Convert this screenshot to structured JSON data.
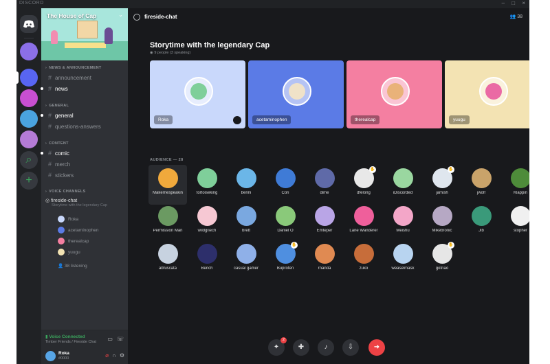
{
  "app": {
    "title": "DISCORD",
    "window_controls": [
      "–",
      "□",
      "×"
    ]
  },
  "servers": [
    {
      "name": "home",
      "color": "#36393f"
    },
    {
      "name": "server-1",
      "color": "#8b6fe8"
    },
    {
      "name": "server-2",
      "color": "#5865f2"
    },
    {
      "name": "server-3",
      "color": "#c94fd1"
    },
    {
      "name": "server-4",
      "color": "#4aa3df"
    },
    {
      "name": "server-5",
      "color": "#b57bd6"
    }
  ],
  "sidebar": {
    "server_name": "The House of Cap",
    "categories": [
      {
        "label": "NEWS & ANNOUNCEMENT",
        "channels": [
          "announcement",
          "news"
        ]
      },
      {
        "label": "GENERAL",
        "channels": [
          "general",
          "questions-answers"
        ]
      },
      {
        "label": "CONTENT",
        "channels": [
          "comic",
          "merch",
          "stickers"
        ]
      },
      {
        "label": "VOICE CHANNELS"
      }
    ],
    "voice_channel": {
      "name": "fireside-chat",
      "topic": "Storytime with the legendary Cap",
      "speakers": [
        "Roka",
        "acetaminophen",
        "therealcap",
        "yuugu"
      ],
      "listening": "38 listening"
    },
    "voice_panel": {
      "status": "Voice Connected",
      "location": "Timber Friends / Fireside Chat"
    },
    "user": {
      "name": "Roka",
      "tag": "#0000"
    }
  },
  "stage": {
    "channel_name": "fireside-chat",
    "member_count": "38",
    "topic": "Storytime with the legendary Cap",
    "subinfo": "9 people (3 speaking)",
    "speakers": [
      {
        "name": "Roka",
        "bg": "#c9d8fb",
        "face": "#7fcf9a"
      },
      {
        "name": "acetaminophen",
        "bg": "#5b7be6",
        "face": "#f0e2c8"
      },
      {
        "name": "therealcap",
        "bg": "#f47fa1",
        "face": "#e9b279"
      },
      {
        "name": "yuugu",
        "bg": "#f3e3b3",
        "face": "#ea6aa4"
      }
    ],
    "audience_label": "AUDIENCE — 28",
    "audience": [
      {
        "name": "Makernespeakin",
        "face": "#f0a93c",
        "hand": false
      },
      {
        "name": "tortoiseking",
        "face": "#7fcf9a",
        "hand": false
      },
      {
        "name": "benni",
        "face": "#6bb6e8",
        "hand": false
      },
      {
        "name": "Cori",
        "face": "#3f7bd6",
        "hand": false
      },
      {
        "name": "dime",
        "face": "#5f6aa8",
        "hand": false
      },
      {
        "name": "dfelong",
        "face": "#e8e8e8",
        "hand": true
      },
      {
        "name": "iDiscorded",
        "face": "#9ad7a0",
        "hand": false
      },
      {
        "name": "jamish",
        "face": "#dfe6ee",
        "hand": true
      },
      {
        "name": "jwolf",
        "face": "#c9a36a",
        "hand": false
      },
      {
        "name": "Klappin",
        "face": "#4e8c3a",
        "hand": false
      },
      {
        "name": "Permission Man",
        "face": "#6b9a62",
        "hand": false
      },
      {
        "name": "wildgriech",
        "face": "#f6c8d3",
        "hand": false
      },
      {
        "name": "brett",
        "face": "#7aa8e0",
        "hand": false
      },
      {
        "name": "Daniel O",
        "face": "#8ac97a",
        "hand": false
      },
      {
        "name": "Emteper",
        "face": "#b9a5e6",
        "hand": false
      },
      {
        "name": "Lane Wanderer",
        "face": "#ef5f9b",
        "hand": false
      },
      {
        "name": "Meishu",
        "face": "#f3a6c8",
        "hand": false
      },
      {
        "name": "Mikebronic",
        "face": "#b6a8c4",
        "hand": false
      },
      {
        "name": "Jib",
        "face": "#3a9a7a",
        "hand": false
      },
      {
        "name": "stopher",
        "face": "#f0f0f0",
        "hand": false
      },
      {
        "name": "abfuscata",
        "face": "#c7d2e0",
        "hand": false
      },
      {
        "name": "Bench",
        "face": "#2d2f6b",
        "hand": false
      },
      {
        "name": "casual gamer",
        "face": "#8fb0e8",
        "hand": false
      },
      {
        "name": "Buprofen",
        "face": "#4f8fe0",
        "hand": true
      },
      {
        "name": "rnanda",
        "face": "#e08a52",
        "hand": false
      },
      {
        "name": "zuko",
        "face": "#c76d3a",
        "hand": false
      },
      {
        "name": "weaselmask",
        "face": "#b8d4f0",
        "hand": false
      },
      {
        "name": "gotnao",
        "face": "#e6e6e6",
        "hand": true
      }
    ],
    "controls": [
      {
        "name": "activities",
        "glyph": "✦",
        "badge": "2"
      },
      {
        "name": "invite",
        "glyph": "✚"
      },
      {
        "name": "microphone",
        "glyph": "♪"
      },
      {
        "name": "move-to-audience",
        "glyph": "⇩"
      },
      {
        "name": "leave",
        "glyph": "➜"
      }
    ]
  }
}
